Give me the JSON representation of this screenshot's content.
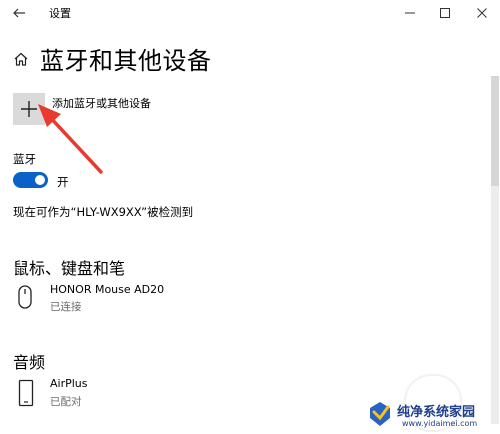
{
  "window": {
    "title": "设置"
  },
  "page": {
    "title": "蓝牙和其他设备"
  },
  "add_device": {
    "label": "添加蓝牙或其他设备",
    "icon": "plus-icon"
  },
  "bluetooth": {
    "label": "蓝牙",
    "toggle_state": "开",
    "discoverable_text": "现在可作为“HLY-WX9XX”被检测到",
    "toggle_color": "#0a62c9"
  },
  "sections": {
    "mouse_keyboard_pen": {
      "title": "鼠标、键盘和笔",
      "devices": [
        {
          "name": "HONOR Mouse AD20",
          "status": "已连接",
          "icon": "mouse-icon"
        }
      ]
    },
    "audio": {
      "title": "音频",
      "devices": [
        {
          "name": "AirPlus",
          "status": "已配对",
          "icon": "phone-icon"
        }
      ]
    }
  },
  "annotation": {
    "arrow_color": "#e83a2f"
  },
  "watermark": {
    "main": "纯净系统家园",
    "url": "www.yidaimei.com"
  }
}
